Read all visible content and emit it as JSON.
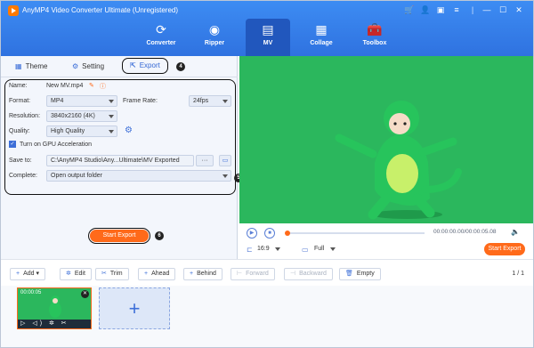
{
  "app": {
    "title": "AnyMP4 Video Converter Ultimate (Unregistered)"
  },
  "main_tabs": [
    {
      "label": "Converter",
      "icon": "converter-icon"
    },
    {
      "label": "Ripper",
      "icon": "disc-icon"
    },
    {
      "label": "MV",
      "icon": "mv-icon",
      "active": true
    },
    {
      "label": "Collage",
      "icon": "collage-icon"
    },
    {
      "label": "Toolbox",
      "icon": "toolbox-icon"
    }
  ],
  "sub_tabs": {
    "theme": "Theme",
    "setting": "Setting",
    "export": "Export"
  },
  "annotations": {
    "export": "4",
    "settings": "5",
    "start": "6"
  },
  "export": {
    "name_label": "Name:",
    "name_value": "New MV.mp4",
    "format_label": "Format:",
    "format_value": "MP4",
    "framerate_label": "Frame Rate:",
    "framerate_value": "24fps",
    "resolution_label": "Resolution:",
    "resolution_value": "3840x2160 (4K)",
    "quality_label": "Quality:",
    "quality_value": "High Quality",
    "gpu_label": "Turn on GPU Acceleration",
    "gpu_checked": true,
    "saveto_label": "Save to:",
    "saveto_value": "C:\\AnyMP4 Studio\\Any...Ultimate\\MV Exported",
    "browse_label": "···",
    "complete_label": "Complete:",
    "complete_value": "Open output folder",
    "start_button": "Start Export"
  },
  "player": {
    "time": "00:00:00.00/00:00:05.08",
    "aspect": "16:9",
    "size": "Full",
    "start_button": "Start Export"
  },
  "toolbar": {
    "add": "Add",
    "edit": "Edit",
    "trim": "Trim",
    "ahead": "Ahead",
    "behind": "Behind",
    "forward": "Forward",
    "backward": "Backward",
    "empty": "Empty",
    "pager": "1 / 1"
  },
  "clip": {
    "duration": "00:00:05",
    "controls": "▷ ◁) ✲ ✂"
  },
  "colors": {
    "accent": "#ff6a1a",
    "header": "#2f72e0",
    "preview_bg": "#2bb75d"
  }
}
